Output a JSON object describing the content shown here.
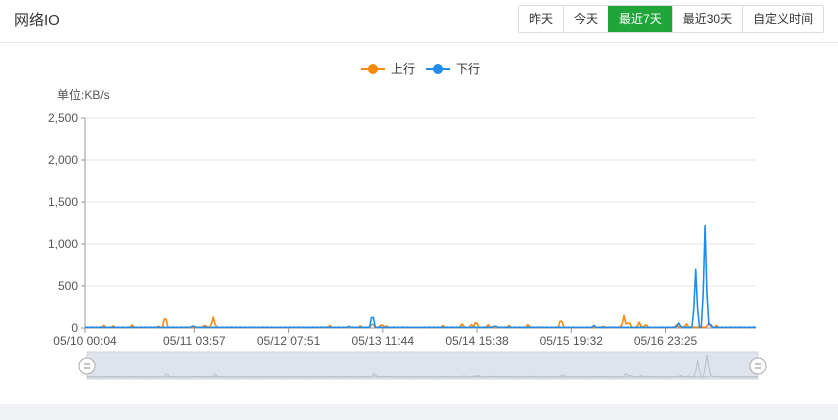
{
  "panel": {
    "title": "网络IO",
    "buttons": [
      {
        "label": "昨天",
        "active": false
      },
      {
        "label": "今天",
        "active": false
      },
      {
        "label": "最近7天",
        "active": true
      },
      {
        "label": "最近30天",
        "active": false
      },
      {
        "label": "自定义时间",
        "active": false
      }
    ]
  },
  "colors": {
    "accent": "#20a53a",
    "up": "#f7890c",
    "down": "#1f8ceb"
  },
  "chart_data": {
    "type": "line",
    "unit_label": "单位:KB/s",
    "legend_position": "top-center",
    "grid": true,
    "ylim": [
      0,
      2500
    ],
    "yticks": [
      "2,500",
      "2,000",
      "1,500",
      "1,000",
      "500",
      "0"
    ],
    "xlim": [
      0,
      7.12
    ],
    "xticks": [
      {
        "pos": 0.0,
        "label": "05/10 00:04"
      },
      {
        "pos": 1.16,
        "label": "05/11 03:57"
      },
      {
        "pos": 2.16,
        "label": "05/12 07:51"
      },
      {
        "pos": 3.16,
        "label": "05/13 11:44"
      },
      {
        "pos": 4.16,
        "label": "05/14 15:38"
      },
      {
        "pos": 5.16,
        "label": "05/15 19:32"
      },
      {
        "pos": 6.16,
        "label": "05/16 23:25"
      }
    ],
    "series": [
      {
        "name": "上行",
        "color": "#f7890c",
        "peaks": [
          [
            0.2,
            30
          ],
          [
            0.3,
            25
          ],
          [
            0.5,
            35
          ],
          [
            0.78,
            20
          ],
          [
            0.85,
            160
          ],
          [
            1.27,
            40
          ],
          [
            1.36,
            130
          ],
          [
            2.6,
            30
          ],
          [
            2.92,
            25
          ],
          [
            3.05,
            60
          ],
          [
            3.15,
            50
          ],
          [
            3.2,
            25
          ],
          [
            3.8,
            30
          ],
          [
            4.0,
            50
          ],
          [
            4.1,
            40
          ],
          [
            4.15,
            90
          ],
          [
            4.28,
            40
          ],
          [
            4.5,
            30
          ],
          [
            4.7,
            40
          ],
          [
            5.05,
            120
          ],
          [
            5.5,
            20
          ],
          [
            5.7,
            30
          ],
          [
            5.72,
            150
          ],
          [
            5.77,
            90
          ],
          [
            5.88,
            70
          ],
          [
            5.95,
            50
          ],
          [
            6.28,
            40
          ],
          [
            6.38,
            50
          ],
          [
            6.62,
            60
          ],
          [
            6.7,
            30
          ]
        ]
      },
      {
        "name": "下行",
        "color": "#1f8ceb",
        "peaks": [
          [
            1.15,
            30
          ],
          [
            2.8,
            20
          ],
          [
            3.05,
            190
          ],
          [
            4.35,
            30
          ],
          [
            5.4,
            30
          ],
          [
            6.3,
            60
          ],
          [
            6.48,
            700
          ],
          [
            6.58,
            1220
          ],
          [
            6.63,
            60
          ]
        ]
      }
    ]
  }
}
